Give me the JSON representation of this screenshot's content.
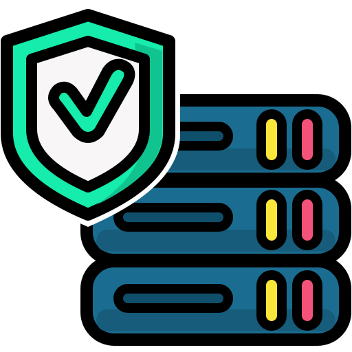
{
  "icon": {
    "name": "secure-server-icon",
    "parts": [
      "shield-icon",
      "checkmark-icon",
      "server-rack-icon"
    ]
  },
  "colors": {
    "outline": "#000000",
    "server_body": "#1a6d91",
    "server_shadow": "#175c7b",
    "slot": "#0f4f6b",
    "led_yellow": "#f9e63a",
    "led_pink": "#f4527a",
    "shield_border": "#16ecac",
    "shield_border_shade": "#10c48f",
    "shield_inner": "#f8f6f6",
    "check_fill": "#16ecac"
  }
}
